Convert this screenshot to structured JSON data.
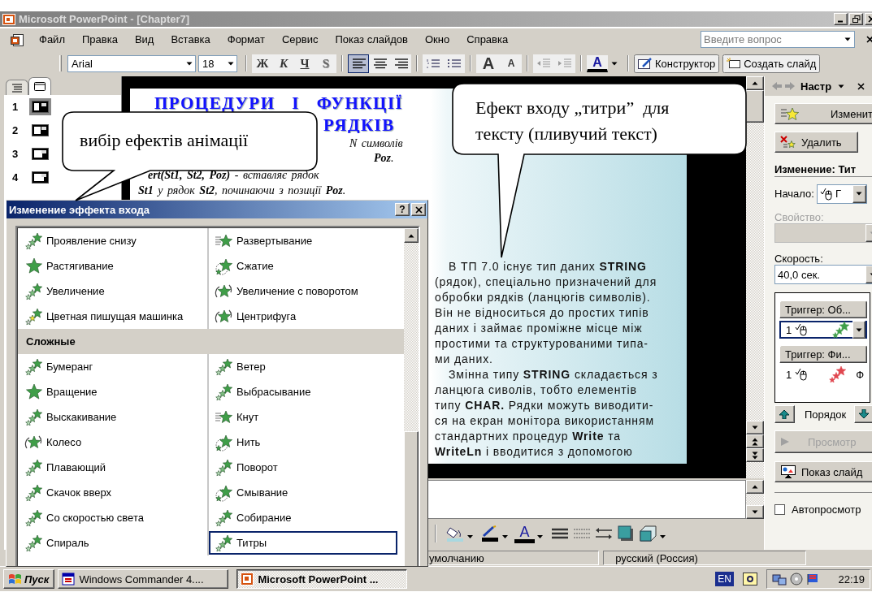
{
  "window": {
    "title": "Microsoft PowerPoint - [Chapter7]"
  },
  "menu": {
    "items": [
      "Файл",
      "Правка",
      "Вид",
      "Вставка",
      "Формат",
      "Сервис",
      "Показ слайдов",
      "Окно",
      "Справка"
    ],
    "help_field": {
      "placeholder": "Введите вопрос"
    }
  },
  "toolbar": {
    "font": "Arial",
    "size": "18",
    "styles": [
      {
        "kind": "bold",
        "label": "Ж"
      },
      {
        "kind": "italic",
        "label": "К"
      },
      {
        "kind": "underline",
        "label": "Ч"
      },
      {
        "kind": "shadow",
        "label": "S"
      }
    ],
    "align": [
      {
        "kind": "left",
        "selected": true
      },
      {
        "kind": "center",
        "selected": false
      },
      {
        "kind": "right",
        "selected": false
      }
    ],
    "grow_font": "A",
    "shrink_font": "A",
    "font_color": "A",
    "designer": "Конструктор",
    "new_slide": "Создать слайд"
  },
  "pane_tabs": [
    {
      "kind": "outline",
      "selected": false
    },
    {
      "kind": "slides",
      "selected": true
    }
  ],
  "thumbnails": [
    {
      "number": "1",
      "selected": true
    },
    {
      "number": "2",
      "selected": false
    },
    {
      "number": "3",
      "selected": false
    },
    {
      "number": "4",
      "selected": false
    }
  ],
  "slide": {
    "title_lines": [
      "ПРОЦЕДУРИ І ФУНКЦІЇ",
      "РЯДКІВ"
    ],
    "fragments": [
      "N символів",
      "**Poz**.",
      "**ert(St1, St2, Poz)** - вставляє рядок",
      "**St1** у рядок **St2**, починаючи з позиції **Poz**."
    ],
    "paragraphs": [
      "В ТП 7.0 існує тип даних **STRING**\n(рядок), спеціально призначений для\nобробки рядків (ланцюгів символів).\nВін не відноситься до простих типів\nданих і займає проміжне місце між\nпростими та структурованими типа-\nми даних.",
      "Змінна типу **STRING** складається з\nланцюга сиволів, тобто елементів\nтипу **CHAR.** Рядки можуть виводити-\nся на екран монітора використанням\nстандартних процедур **Write** та\n**WriteLn** і вводитися з допомогою"
    ]
  },
  "callouts": [
    {
      "text": "вибір ефектів анімації"
    },
    {
      "text": "Ефект входу „титри”  для\nтексту (пливучий текст)"
    }
  ],
  "dialog": {
    "title": "Изменение эффекта входа",
    "help_button": "?",
    "groups": [
      {
        "items": [
          {
            "label": "Проявление снизу",
            "kind": "trail",
            "selected": false
          },
          {
            "label": "Развертывание",
            "kind": "lines",
            "selected": false
          },
          {
            "label": "Растягивание",
            "kind": "big",
            "selected": false
          },
          {
            "label": "Сжатие",
            "kind": "swirl",
            "selected": false
          },
          {
            "label": "Увеличение",
            "kind": "trail",
            "selected": false
          },
          {
            "label": "Увеличение с поворотом",
            "kind": "spin",
            "selected": false
          },
          {
            "label": "Цветная пишущая машинка",
            "kind": "color",
            "selected": false
          },
          {
            "label": "Центрифуга",
            "kind": "spin",
            "selected": false
          }
        ]
      },
      {
        "header": "Сложные",
        "items": [
          {
            "label": "Бумеранг",
            "kind": "trail",
            "selected": false
          },
          {
            "label": "Ветер",
            "kind": "trail",
            "selected": false
          },
          {
            "label": "Вращение",
            "kind": "big",
            "selected": false
          },
          {
            "label": "Выбрасывание",
            "kind": "trail",
            "selected": false
          },
          {
            "label": "Выскакивание",
            "kind": "trail",
            "selected": false
          },
          {
            "label": "Кнут",
            "kind": "lines",
            "selected": false
          },
          {
            "label": "Колесо",
            "kind": "spin",
            "selected": false
          },
          {
            "label": "Нить",
            "kind": "swirl",
            "selected": false
          },
          {
            "label": "Плавающий",
            "kind": "trail",
            "selected": false
          },
          {
            "label": "Поворот",
            "kind": "trail",
            "selected": false
          },
          {
            "label": "Скачок вверх",
            "kind": "trail",
            "selected": false
          },
          {
            "label": "Смывание",
            "kind": "swirl",
            "selected": false
          },
          {
            "label": "Со скоростью света",
            "kind": "trail",
            "selected": false
          },
          {
            "label": "Собирание",
            "kind": "trail",
            "selected": false
          },
          {
            "label": "Спираль",
            "kind": "trail",
            "selected": false
          },
          {
            "label": "Титры",
            "kind": "trail",
            "selected": true
          }
        ]
      }
    ]
  },
  "task_pane": {
    "title": "Настр",
    "change_button": "Изменит",
    "remove_button": "Удалить",
    "effect_heading": "Изменение: Тит",
    "start": {
      "label": "Начало:",
      "value": "Г"
    },
    "property": {
      "label": "Свойство:",
      "disabled": true
    },
    "speed": {
      "label": "Скорость:",
      "value": "40,0 сек."
    },
    "triggers": [
      {
        "header": "Триггер: Об...",
        "items": [
          {
            "order": "1",
            "color": "#3f9e48",
            "selected": true
          }
        ]
      },
      {
        "header": "Триггер: Фи...",
        "items": [
          {
            "order": "1",
            "color": "#e0464f",
            "label": "Ф",
            "selected": false
          }
        ]
      }
    ],
    "order_label": "Порядок",
    "preview_button": {
      "label": "Просмотр",
      "disabled": true
    },
    "slideshow_button": "Показ слайд",
    "autopreview": {
      "label": "Автопросмотр",
      "checked": false
    }
  },
  "drawing_toolbar": {
    "font_color": "A"
  },
  "status_bar": [
    "умолчанию",
    "русский (Россия)"
  ],
  "taskbar": {
    "start": "Пуск",
    "tasks": [
      {
        "label": "Windows Commander 4....",
        "selected": false
      },
      {
        "label": "Microsoft PowerPoint ...",
        "selected": true
      }
    ],
    "language": "EN",
    "time": "22:19"
  }
}
